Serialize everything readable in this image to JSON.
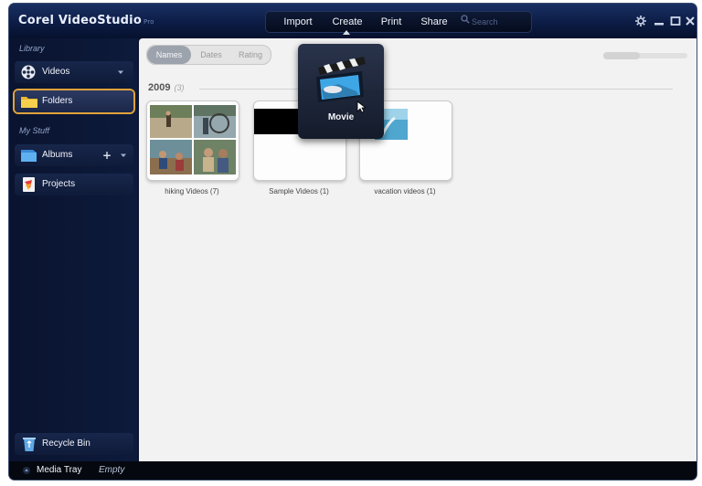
{
  "app": {
    "title": "Corel VideoStudio",
    "title_suffix": "Pro"
  },
  "topnav": {
    "items": [
      "Import",
      "Create",
      "Print",
      "Share"
    ],
    "search_placeholder": "Search"
  },
  "sidebar": {
    "library_label": "Library",
    "mystuff_label": "My Stuff",
    "videos": "Videos",
    "folders": "Folders",
    "albums": "Albums",
    "projects": "Projects",
    "recycle": "Recycle Bin",
    "albums_add": "+"
  },
  "sort": {
    "tabs": [
      "Names",
      "Dates",
      "Rating"
    ],
    "active": "Names"
  },
  "group": {
    "year": "2009",
    "count": "(3)"
  },
  "folders": [
    {
      "caption": "hiking Videos (7)"
    },
    {
      "caption": "Sample Videos (1)"
    },
    {
      "caption": "vacation videos (1)"
    }
  ],
  "create_menu": {
    "item": "Movie"
  },
  "media_tray": {
    "label": "Media Tray",
    "status": "Empty"
  },
  "colors": {
    "selection_outline": "#e0a33a",
    "chrome_dark": "#0b1633",
    "content_bg": "#f2f2f2"
  }
}
